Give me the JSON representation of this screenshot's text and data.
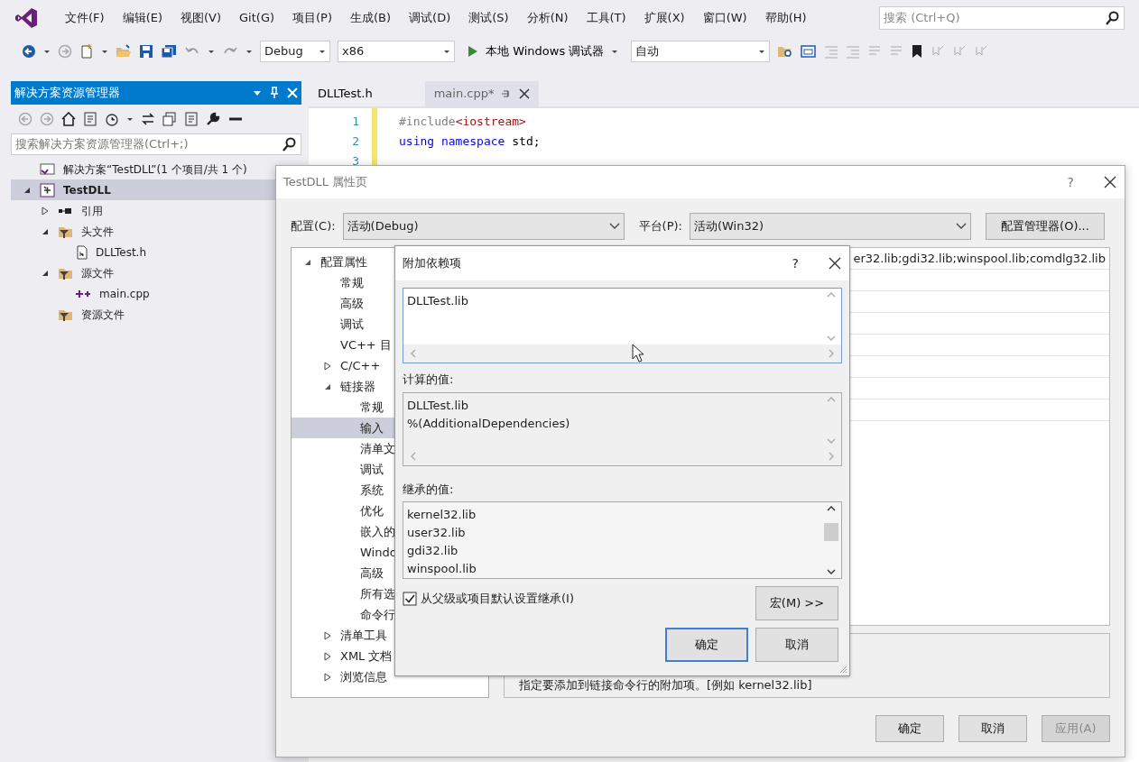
{
  "menu_bar": {
    "items": [
      "文件(F)",
      "编辑(E)",
      "视图(V)",
      "Git(G)",
      "项目(P)",
      "生成(B)",
      "调试(D)",
      "测试(S)",
      "分析(N)",
      "工具(T)",
      "扩展(X)",
      "窗口(W)",
      "帮助(H)"
    ],
    "search_placeholder": "搜索 (Ctrl+Q)"
  },
  "toolbar": {
    "configuration": "Debug",
    "platform": "x86",
    "run_button": "本地 Windows 调试器",
    "launch_mode": "自动"
  },
  "solution_explorer": {
    "title": "解决方案资源管理器",
    "search_placeholder": "搜索解决方案资源管理器(Ctrl+;)",
    "tree": [
      {
        "label": "解决方案“TestDLL”(1 个项目/共 1 个)",
        "kind": "solution",
        "selected": false
      },
      {
        "label": "TestDLL",
        "kind": "project",
        "selected": true,
        "expanded": true,
        "children": [
          {
            "label": "引用",
            "kind": "references",
            "selected": false,
            "expanded": false
          },
          {
            "label": "头文件",
            "kind": "folder",
            "selected": false,
            "expanded": true,
            "children": [
              {
                "label": "DLLTest.h",
                "kind": "header",
                "selected": false
              }
            ]
          },
          {
            "label": "源文件",
            "kind": "folder",
            "selected": false,
            "expanded": true,
            "children": [
              {
                "label": "main.cpp",
                "kind": "cpp",
                "selected": false
              }
            ]
          },
          {
            "label": "资源文件",
            "kind": "folder",
            "selected": false
          }
        ]
      }
    ]
  },
  "editor": {
    "tabs": [
      {
        "label": "DLLTest.h",
        "selected": false
      },
      {
        "label": "main.cpp*",
        "selected": true
      }
    ],
    "lines": [
      {
        "number": "1",
        "tokens": [
          {
            "text": "#include",
            "kind": "directive"
          },
          {
            "text": "<iostream>",
            "kind": "string"
          }
        ]
      },
      {
        "number": "2",
        "tokens": [
          {
            "text": "using namespace",
            "kind": "keyword"
          },
          {
            "text": " std;",
            "kind": "plain"
          }
        ]
      },
      {
        "number": "3"
      }
    ]
  },
  "property_dialog": {
    "title": "TestDLL 属性页",
    "help": "?",
    "configuration_label": "配置(C):",
    "configuration": "活动(Debug)",
    "platform_label": "平台(P):",
    "platform": "活动(Win32)",
    "manager_button": "配置管理器(O)...",
    "tree": [
      {
        "label": "配置属性",
        "selected": false,
        "expanded": true,
        "children": [
          {
            "label": "常规",
            "selected": false
          },
          {
            "label": "高级",
            "selected": false
          },
          {
            "label": "调试",
            "selected": false
          },
          {
            "label": "VC++ 目",
            "selected": false
          },
          {
            "label": "C/C++",
            "selected": false,
            "expanded": false
          },
          {
            "label": "链接器",
            "selected": false,
            "expanded": true,
            "children": [
              {
                "label": "常规",
                "selected": false
              },
              {
                "label": "输入",
                "selected": true
              },
              {
                "label": "清单文",
                "selected": false
              },
              {
                "label": "调试",
                "selected": false
              },
              {
                "label": "系统",
                "selected": false
              },
              {
                "label": "优化",
                "selected": false
              },
              {
                "label": "嵌入的",
                "selected": false
              },
              {
                "label": "Windo",
                "selected": false
              },
              {
                "label": "高级",
                "selected": false
              },
              {
                "label": "所有选",
                "selected": false
              },
              {
                "label": "命令行",
                "selected": false
              }
            ]
          },
          {
            "label": "清单工具",
            "selected": false,
            "expanded": false
          },
          {
            "label": "XML 文档",
            "selected": false,
            "expanded": false
          },
          {
            "label": "浏览信息",
            "selected": false,
            "expanded": false
          }
        ]
      }
    ],
    "property_value": "er32.lib;gdi32.lib;winspool.lib;comdlg32.lib",
    "description": "指定要添加到链接命令行的附加项。[例如 kernel32.lib]",
    "buttons": [
      {
        "label": "确定",
        "disabled": false
      },
      {
        "label": "取消",
        "disabled": false
      },
      {
        "label": "应用(A)",
        "disabled": true
      }
    ]
  },
  "dependencies_dialog": {
    "title": "附加依赖项",
    "help": "?",
    "value": "DLLTest.lib",
    "computed_label": "计算的值:",
    "computed": [
      "DLLTest.lib",
      "%(AdditionalDependencies)"
    ],
    "inherited_label": "继承的值:",
    "inherited": [
      "kernel32.lib",
      "user32.lib",
      "gdi32.lib",
      "winspool.lib"
    ],
    "inherit_checkbox": {
      "label": "从父级或项目默认设置继承(I)",
      "checked": true
    },
    "macro_button": "宏(M) >>",
    "buttons": [
      {
        "label": "确定",
        "default": true
      },
      {
        "label": "取消",
        "default": false
      }
    ]
  }
}
